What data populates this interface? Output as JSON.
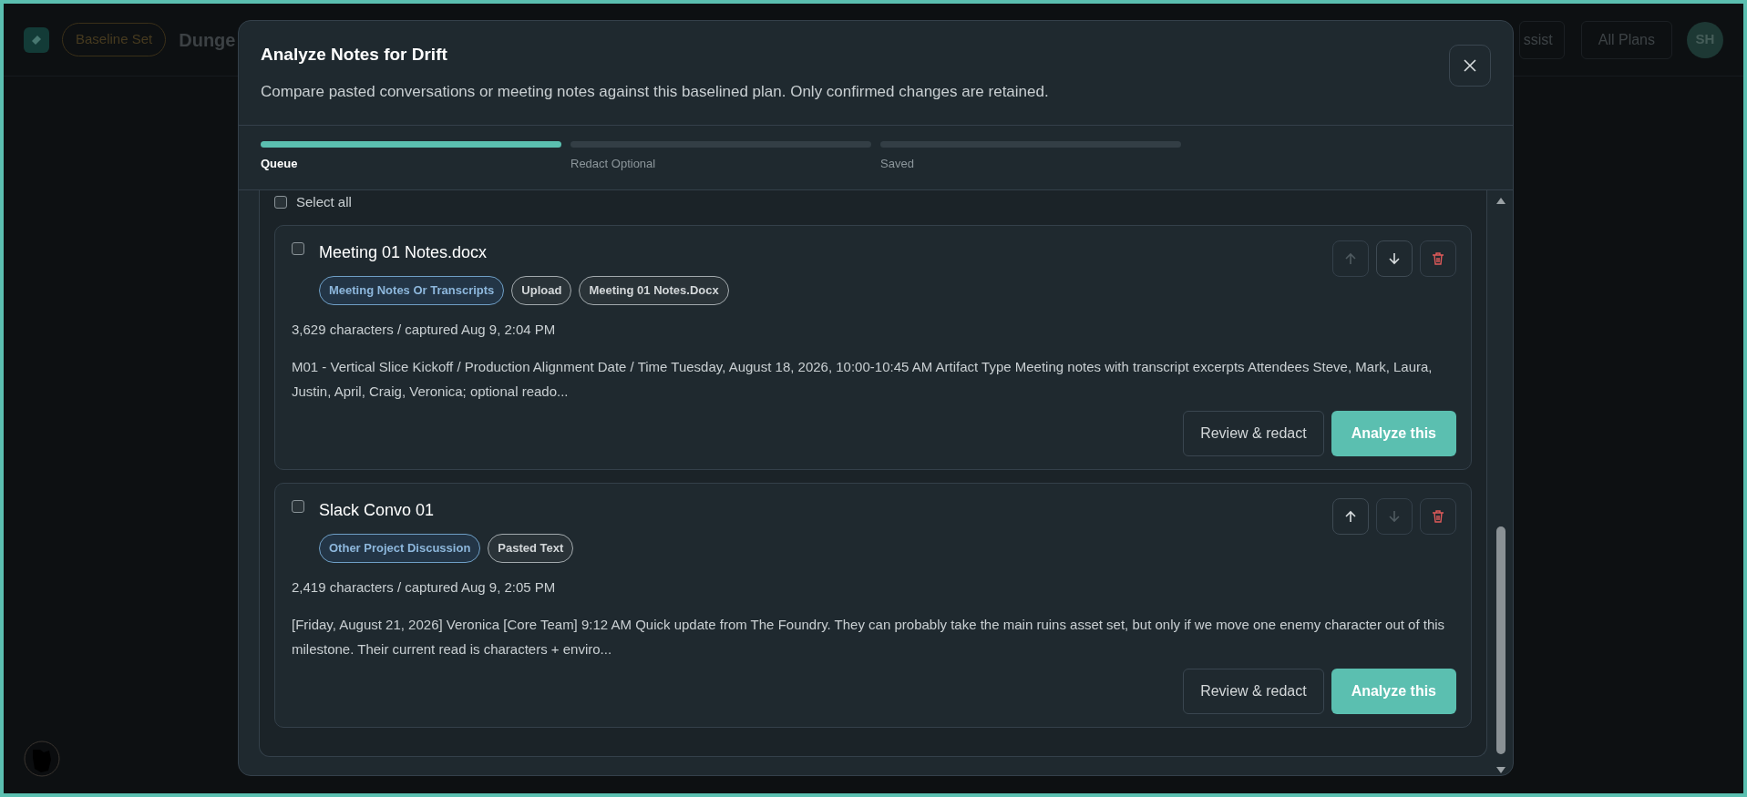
{
  "header": {
    "status_badge": "Baseline Set",
    "title": "Dunge",
    "buttons": [
      "ssist",
      "All Plans"
    ],
    "avatar": "SH"
  },
  "modal": {
    "title": "Analyze Notes for Drift",
    "subtitle": "Compare pasted conversations or meeting notes against this baselined plan. Only confirmed changes are retained.",
    "steps": [
      {
        "label": "Queue",
        "selected": true
      },
      {
        "label": "Redact Optional",
        "selected": false
      },
      {
        "label": "Saved",
        "selected": false
      }
    ],
    "select_all": {
      "label": "Select all",
      "checked": false
    },
    "items": [
      {
        "title": "Meeting 01 Notes.docx",
        "checked": false,
        "tags": [
          {
            "label": "Meeting Notes Or Transcripts",
            "kind": "category"
          },
          {
            "label": "Upload",
            "kind": "plain"
          },
          {
            "label": "Meeting 01 Notes.Docx",
            "kind": "plain"
          }
        ],
        "meta": "3,629 characters / captured Aug 9, 2:04 PM",
        "excerpt": "M01 - Vertical Slice Kickoff / Production Alignment Date / Time Tuesday, August 18, 2026, 10:00-10:45 AM Artifact Type Meeting notes with transcript excerpts Attendees Steve, Mark, Laura, Justin, April, Craig, Veronica; optional reado...",
        "up_disabled": true,
        "down_disabled": false,
        "buttons": [
          "Review & redact",
          "Analyze this"
        ]
      },
      {
        "title": "Slack Convo 01",
        "checked": false,
        "tags": [
          {
            "label": "Other Project Discussion",
            "kind": "category"
          },
          {
            "label": "Pasted Text",
            "kind": "plain"
          }
        ],
        "meta": "2,419 characters / captured Aug 9, 2:05 PM",
        "excerpt": "[Friday, August 21, 2026] Veronica [Core Team] 9:12 AM Quick update from The Foundry. They can probably take the main ruins asset set, but only if we move one enemy character out of this milestone. Their current read is characters + enviro...",
        "up_disabled": false,
        "down_disabled": true,
        "buttons": [
          "Review & redact",
          "Analyze this"
        ]
      }
    ]
  }
}
